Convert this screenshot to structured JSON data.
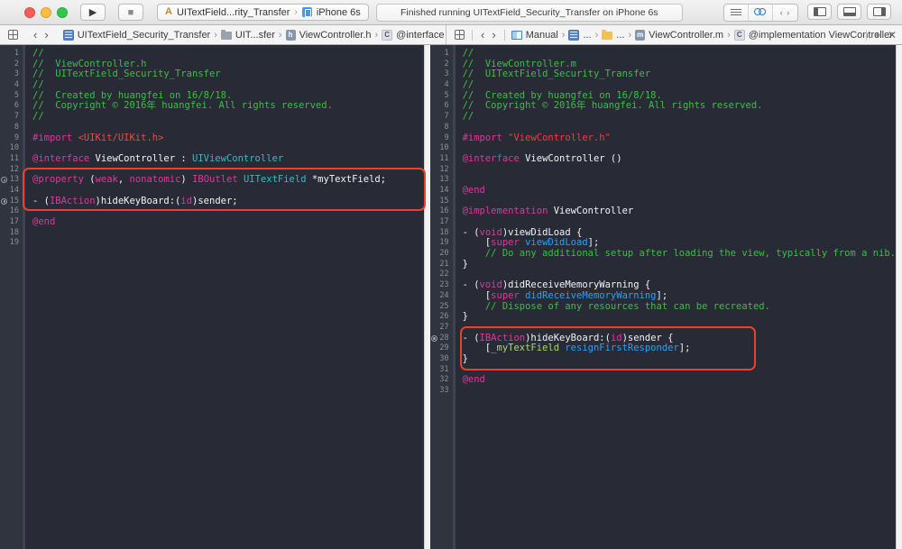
{
  "colors": {
    "comment": "#3ebd46",
    "keyword": "#d73a9c",
    "string": "#ee3e3e",
    "header": "#dc5340",
    "plain": "#f2f3f7",
    "type": "#38b8c4",
    "method": "#2d9ff2",
    "ivar": "#a6d96e",
    "annotation": "#e8432a",
    "editor_background": "#282b35",
    "gutter_background": "#30343f"
  },
  "icons": {
    "run_glyph": "▶",
    "stop_glyph": "■",
    "back_glyph": "‹",
    "forward_glyph": "›",
    "crumb_separator": "›",
    "scheme_separator": "›",
    "target_glyph": "A",
    "version_editor_glyph": "‹ ›"
  },
  "toolbar": {
    "scheme_target": "UITextField...rity_Transfer",
    "scheme_device": "iPhone 6s",
    "status_text": "Finished running UITextField_Security_Transfer on iPhone 6s"
  },
  "jumpbar_left": {
    "crumbs": [
      {
        "icon": "project",
        "label": "UITextField_Security_Transfer"
      },
      {
        "icon": "folder-gray",
        "label": "UIT...sfer"
      },
      {
        "icon": "file-h",
        "label": "ViewController.h"
      },
      {
        "icon": "symbol-c",
        "label": "@interface ViewController"
      }
    ]
  },
  "jumpbar_right": {
    "crumbs": [
      {
        "icon": "manual",
        "label": "Manual"
      },
      {
        "icon": "project",
        "label": "..."
      },
      {
        "icon": "folder-yellow",
        "label": "..."
      },
      {
        "icon": "file-m",
        "label": "ViewController.m"
      },
      {
        "icon": "symbol-c",
        "label": "@implementation ViewController"
      }
    ],
    "add_label": "+",
    "close_label": "✕"
  },
  "editors": {
    "left": {
      "file": "ViewController.h",
      "line_count": 19,
      "indicators": [
        13,
        15
      ],
      "lines": [
        [
          [
            "c",
            "//"
          ]
        ],
        [
          [
            "c",
            "//  ViewController.h"
          ]
        ],
        [
          [
            "c",
            "//  UITextField_Security_Transfer"
          ]
        ],
        [
          [
            "c",
            "//"
          ]
        ],
        [
          [
            "c",
            "//  Created by huangfei on 16/8/18."
          ]
        ],
        [
          [
            "c",
            "//  Copyright © 2016年 huangfei. All rights reserved."
          ]
        ],
        [
          [
            "c",
            "//"
          ]
        ],
        [],
        [
          [
            "k",
            "#import"
          ],
          [
            "p",
            " "
          ],
          [
            "h",
            "<UIKit/UIKit.h>"
          ]
        ],
        [],
        [
          [
            "k",
            "@interface"
          ],
          [
            "p",
            " ViewController : "
          ],
          [
            "t",
            "UIViewController"
          ]
        ],
        [],
        [
          [
            "k",
            "@property"
          ],
          [
            "p",
            " ("
          ],
          [
            "k",
            "weak"
          ],
          [
            "p",
            ", "
          ],
          [
            "k",
            "nonatomic"
          ],
          [
            "p",
            ") "
          ],
          [
            "k",
            "IBOutlet"
          ],
          [
            "p",
            " "
          ],
          [
            "t",
            "UITextField"
          ],
          [
            "p",
            " *myTextField;"
          ]
        ],
        [],
        [
          [
            "p",
            "- ("
          ],
          [
            "k",
            "IBAction"
          ],
          [
            "p",
            ")hideKeyBoard:("
          ],
          [
            "k",
            "id"
          ],
          [
            "p",
            ")sender;"
          ]
        ],
        [],
        [
          [
            "k",
            "@end"
          ]
        ],
        [],
        []
      ]
    },
    "right": {
      "file": "ViewController.m",
      "line_count": 33,
      "indicators": [
        28
      ],
      "lines": [
        [
          [
            "c",
            "//"
          ]
        ],
        [
          [
            "c",
            "//  ViewController.m"
          ]
        ],
        [
          [
            "c",
            "//  UITextField_Security_Transfer"
          ]
        ],
        [
          [
            "c",
            "//"
          ]
        ],
        [
          [
            "c",
            "//  Created by huangfei on 16/8/18."
          ]
        ],
        [
          [
            "c",
            "//  Copyright © 2016年 huangfei. All rights reserved."
          ]
        ],
        [
          [
            "c",
            "//"
          ]
        ],
        [],
        [
          [
            "k",
            "#import"
          ],
          [
            "p",
            " "
          ],
          [
            "s",
            "\"ViewController.h\""
          ]
        ],
        [],
        [
          [
            "k",
            "@interface"
          ],
          [
            "p",
            " ViewController ()"
          ]
        ],
        [],
        [],
        [
          [
            "k",
            "@end"
          ]
        ],
        [],
        [
          [
            "k",
            "@implementation"
          ],
          [
            "p",
            " ViewController"
          ]
        ],
        [],
        [
          [
            "p",
            "- ("
          ],
          [
            "k",
            "void"
          ],
          [
            "p",
            ")viewDidLoad {"
          ]
        ],
        [
          [
            "p",
            "    ["
          ],
          [
            "k",
            "super"
          ],
          [
            "p",
            " "
          ],
          [
            "m",
            "viewDidLoad"
          ],
          [
            "p",
            "];"
          ]
        ],
        [
          [
            "c",
            "    // Do any additional setup after loading the view, typically from a nib."
          ]
        ],
        [
          [
            "p",
            "}"
          ]
        ],
        [],
        [
          [
            "p",
            "- ("
          ],
          [
            "k",
            "void"
          ],
          [
            "p",
            ")didReceiveMemoryWarning {"
          ]
        ],
        [
          [
            "p",
            "    ["
          ],
          [
            "k",
            "super"
          ],
          [
            "p",
            " "
          ],
          [
            "m",
            "didReceiveMemoryWarning"
          ],
          [
            "p",
            "];"
          ]
        ],
        [
          [
            "c",
            "    // Dispose of any resources that can be recreated."
          ]
        ],
        [
          [
            "p",
            "}"
          ]
        ],
        [],
        [
          [
            "p",
            "- ("
          ],
          [
            "k",
            "IBAction"
          ],
          [
            "p",
            ")hideKeyBoard:("
          ],
          [
            "k",
            "id"
          ],
          [
            "p",
            ")sender {"
          ]
        ],
        [
          [
            "p",
            "    ["
          ],
          [
            "v",
            "_myTextField"
          ],
          [
            "p",
            " "
          ],
          [
            "m",
            "resignFirstResponder"
          ],
          [
            "p",
            "];"
          ]
        ],
        [
          [
            "p",
            "}"
          ]
        ],
        [],
        [
          [
            "k",
            "@end"
          ]
        ],
        []
      ]
    }
  }
}
